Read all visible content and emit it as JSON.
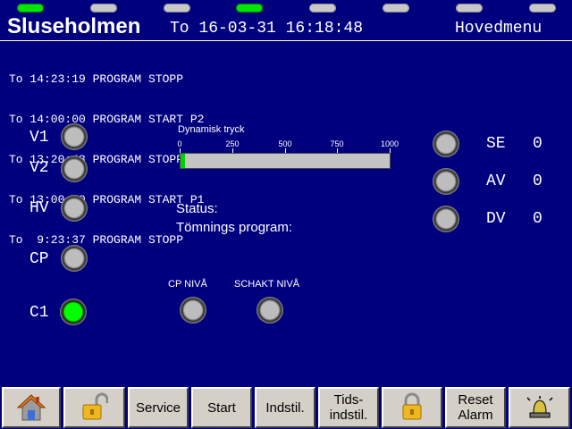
{
  "header": {
    "title": "Sluseholmen",
    "datetime": "To 16-03-31 16:18:48",
    "menu": "Hovedmenu"
  },
  "top_indicators": [
    {
      "state": "on"
    },
    {
      "state": "off"
    },
    {
      "state": "off"
    },
    {
      "state": "on"
    },
    {
      "state": "off"
    },
    {
      "state": "off"
    },
    {
      "state": "off"
    },
    {
      "state": "off"
    }
  ],
  "log": [
    "To 14:23:19 PROGRAM STOPP",
    "To 14:00:00 PROGRAM START P2",
    "To 13:20:48 PROGRAM STOPP",
    "To 13:00:00 PROGRAM START P1",
    "To  9:23:37 PROGRAM STOPP"
  ],
  "valves": [
    {
      "label": "V1",
      "state": "off"
    },
    {
      "label": "V2",
      "state": "off"
    },
    {
      "label": "HV",
      "state": "off"
    },
    {
      "label": "CP",
      "state": "off"
    },
    {
      "label": "C1",
      "state": "on"
    }
  ],
  "gauge": {
    "title": "Dynamisk tryck",
    "ticks": [
      "0",
      "250",
      "500",
      "750",
      "1000"
    ],
    "value": 20,
    "max": 1000,
    "fill_color": "#00d000"
  },
  "status": {
    "status_label": "Status:",
    "program_label": "Tömnings program:"
  },
  "levels": {
    "cp_label": "CP NIVÅ",
    "schakt_label": "SCHAKT NIVÅ"
  },
  "counters": [
    {
      "label": "SE",
      "value": "0"
    },
    {
      "label": "AV",
      "value": "0"
    },
    {
      "label": "DV",
      "value": "0"
    }
  ],
  "toolbar": {
    "home_icon": "home-icon",
    "unlock_icon": "unlock-icon",
    "service": "Service",
    "start": "Start",
    "indstil": "Indstil.",
    "tidsindstil": "Tids-\nindstil.",
    "lock_icon": "lock-icon",
    "reset_alarm": "Reset\nAlarm",
    "alarm_icon": "alarm-bell-icon"
  },
  "colors": {
    "background": "#00007e",
    "lamp_on": "#00ff00",
    "lamp_off": "#bdbdbd",
    "indicator_on": "#00e600"
  }
}
